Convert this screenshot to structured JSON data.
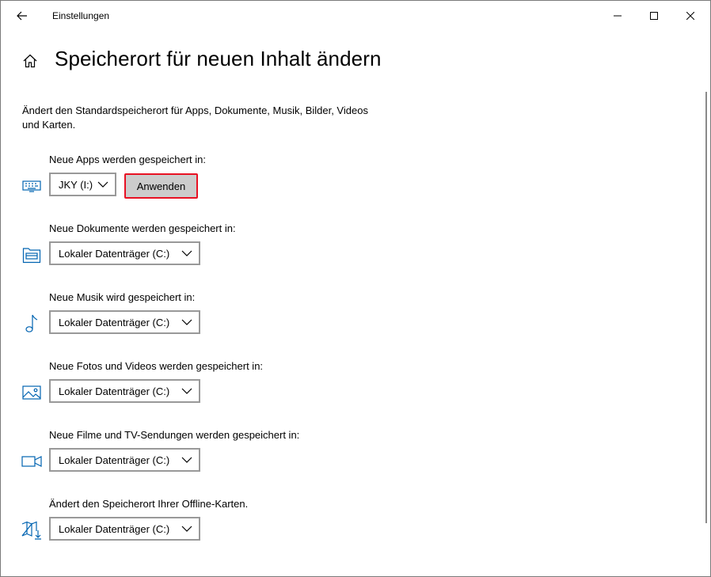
{
  "window": {
    "title": "Einstellungen",
    "controls": {
      "minimize": "minimize-icon",
      "maximize": "maximize-icon",
      "close": "close-icon"
    }
  },
  "page": {
    "title": "Speicherort für neuen Inhalt ändern",
    "description": "Ändert den Standardspeicherort für Apps, Dokumente, Musik, Bilder, Videos und Karten."
  },
  "sections": [
    {
      "label": "Neue Apps werden gespeichert in:",
      "icon": "monitor-icon",
      "value": "JKY (I:)",
      "apply_label": "Anwenden"
    },
    {
      "label": "Neue Dokumente werden gespeichert in:",
      "icon": "documents-folder-icon",
      "value": "Lokaler Datenträger (C:)"
    },
    {
      "label": "Neue Musik wird gespeichert in:",
      "icon": "music-note-icon",
      "value": "Lokaler Datenträger (C:)"
    },
    {
      "label": "Neue Fotos und Videos werden gespeichert in:",
      "icon": "picture-icon",
      "value": "Lokaler Datenträger (C:)"
    },
    {
      "label": "Neue Filme und TV-Sendungen werden gespeichert in:",
      "icon": "video-camera-icon",
      "value": "Lokaler Datenträger (C:)"
    },
    {
      "label": "Ändert den Speicherort Ihrer Offline-Karten.",
      "icon": "map-download-icon",
      "value": "Lokaler Datenträger (C:)"
    }
  ],
  "colors": {
    "accent": "#0063b1",
    "highlight_border": "#e81123",
    "button_bg": "#cccccc",
    "dropdown_border": "#999999"
  }
}
